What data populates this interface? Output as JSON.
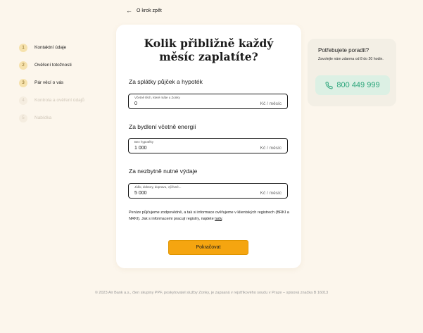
{
  "back_link": "O krok zpět",
  "steps": [
    {
      "num": "1",
      "label": "Kontaktní údaje",
      "active": true
    },
    {
      "num": "2",
      "label": "Ověření totožnosti",
      "active": true
    },
    {
      "num": "3",
      "label": "Pár věcí o vás",
      "active": true
    },
    {
      "num": "4",
      "label": "Kontrola a ověření údajů",
      "active": false
    },
    {
      "num": "5",
      "label": "Nabídka",
      "active": false
    }
  ],
  "card": {
    "title": "Kolik přibližně každý měsíc zaplatíte?",
    "fields": [
      {
        "label": "Za splátky půjček a hypoték",
        "hint": "Včetně těch, které máte u Zonky",
        "value": "0",
        "unit": "Kč / měsíc"
      },
      {
        "label": "Za bydlení včetně energií",
        "hint": "Bez hypotéky",
        "value": "1 000",
        "unit": "Kč / měsíc"
      },
      {
        "label": "Za nezbytně nutné výdaje",
        "hint": "Jídlo, doktory, dopravu, výživné...",
        "value": "5 000",
        "unit": "Kč / měsíc"
      }
    ],
    "info_text": "Peníze půjčujeme zodpovědně, a tak si informace ověřujeme v klientských registrech (BRKI a NRKI). Jak s informacemi pracují registry, najdete",
    "info_link": "tady",
    "continue_button": "Pokračovat"
  },
  "help": {
    "title": "Potřebujete poradit?",
    "subtitle": "Zavolejte nám zdarma od 8 do 20 hodin.",
    "phone": "800 449 999"
  },
  "footer": "© 2023 Air Bank a.s., člen skupiny PPF, poskytovatel služby Zonky, je zapsaná v rejstříkového soudu v Praze – spisová značka B 16013",
  "colors": {
    "background": "#fcf6ec",
    "accent": "#f5a510",
    "phone_green": "#2aa57a",
    "step_badge": "#f6e2ad"
  }
}
